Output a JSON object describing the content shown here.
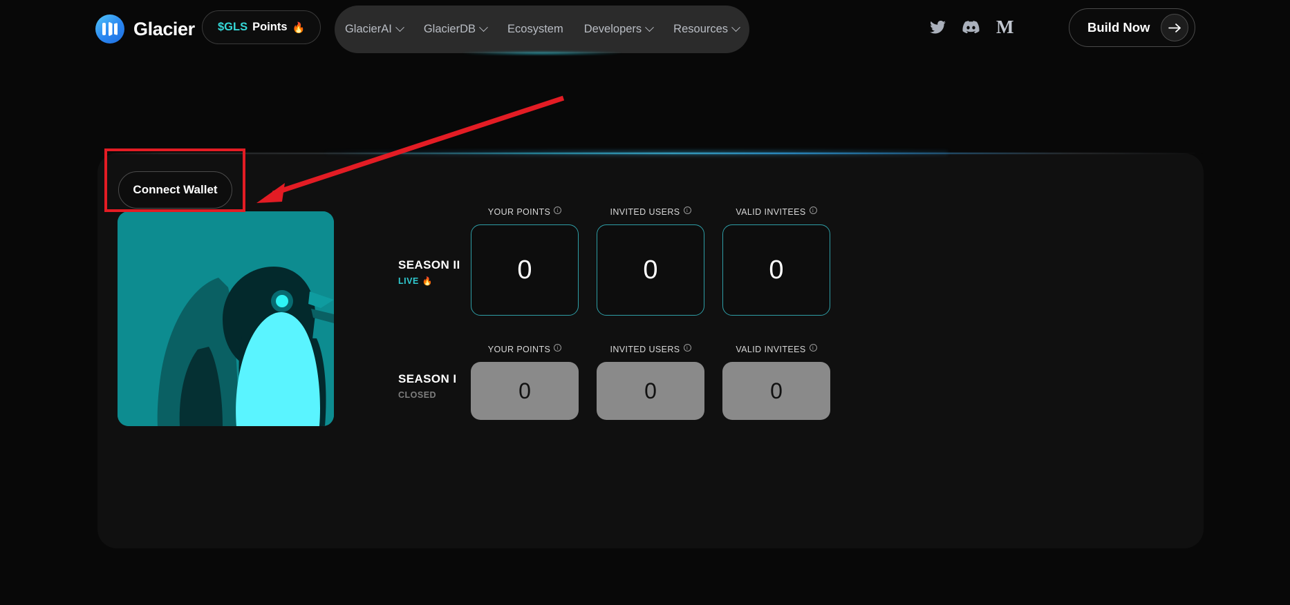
{
  "header": {
    "brand": {
      "name": "Glacier",
      "logo_icon": "glacier-logo-icon"
    },
    "points_pill": {
      "token": "$GLS",
      "label": "Points",
      "flame_icon": "🔥"
    },
    "nav": [
      {
        "label": "GlacierAI",
        "has_dropdown": true
      },
      {
        "label": "GlacierDB",
        "has_dropdown": true
      },
      {
        "label": "Ecosystem",
        "has_dropdown": false
      },
      {
        "label": "Developers",
        "has_dropdown": true
      },
      {
        "label": "Resources",
        "has_dropdown": true
      }
    ],
    "socials": [
      {
        "name": "twitter-icon"
      },
      {
        "name": "discord-icon"
      },
      {
        "name": "medium-icon",
        "glyph": "M"
      }
    ],
    "build_button": {
      "label": "Build Now",
      "arrow_icon": "arrow-right-icon"
    }
  },
  "panel": {
    "connect_wallet_label": "Connect Wallet",
    "penguin_art": "glacier-penguin-illustration"
  },
  "stats": {
    "column_headers": [
      "YOUR POINTS",
      "INVITED USERS",
      "VALID INVITEES"
    ],
    "seasons": [
      {
        "title": "SEASON II",
        "status": "LIVE",
        "status_state": "live",
        "flame_icon": "🔥",
        "values": [
          "0",
          "0",
          "0"
        ]
      },
      {
        "title": "SEASON I",
        "status": "CLOSED",
        "status_state": "closed",
        "flame_icon": "",
        "values": [
          "0",
          "0",
          "0"
        ]
      }
    ]
  },
  "annotation": {
    "highlight_target": "connect-wallet-button",
    "color": "#e31c24"
  },
  "colors": {
    "page_background": "#080808",
    "panel_background": "#101010",
    "accent_cyan": "#2fc9cf",
    "accent_blue": "#2e9ae0",
    "teal_card": "#0d8c90",
    "annotation_red": "#e31c24"
  }
}
